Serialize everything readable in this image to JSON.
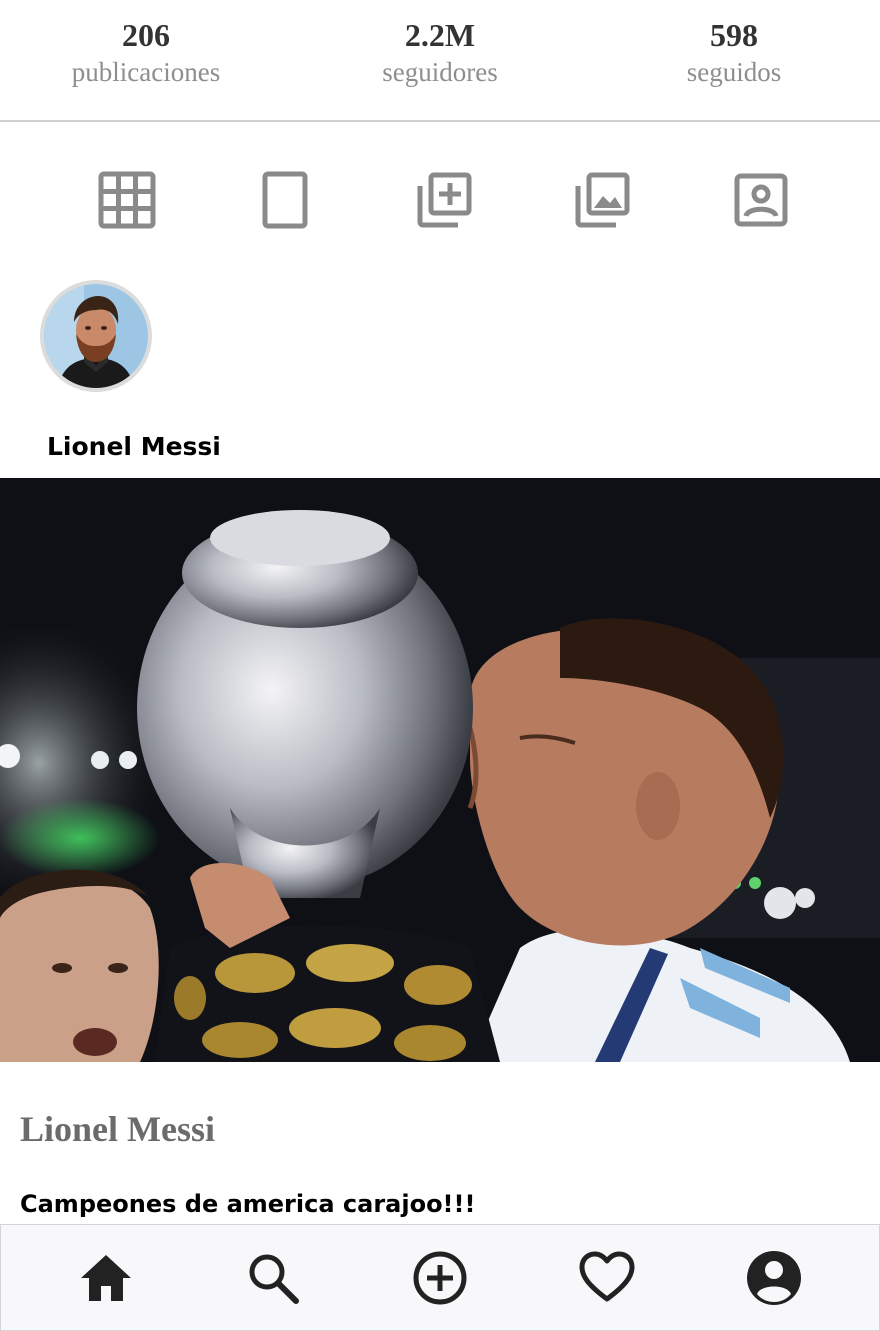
{
  "profile_stats": [
    {
      "value": "206",
      "label": "publicaciones"
    },
    {
      "value": "2.2M",
      "label": "seguidores"
    },
    {
      "value": "598",
      "label": "seguidos"
    }
  ],
  "tabs": [
    {
      "icon": "grid-icon"
    },
    {
      "icon": "portrait-tablet-icon"
    },
    {
      "icon": "add-to-library-icon"
    },
    {
      "icon": "photo-library-icon"
    },
    {
      "icon": "tagged-person-icon"
    }
  ],
  "post": {
    "username": "Lionel Messi",
    "avatar_icon": "profile-avatar",
    "image_alt_description": "player-kissing-trophy-photo",
    "caption_name": "Lionel Messi",
    "caption_text": "Campeones de america carajoo!!!"
  },
  "bottom_nav": [
    {
      "icon": "home-icon"
    },
    {
      "icon": "search-icon"
    },
    {
      "icon": "add-circle-icon"
    },
    {
      "icon": "heart-icon"
    },
    {
      "icon": "account-circle-icon"
    }
  ],
  "colors": {
    "icon_gray": "#8a8a8a",
    "nav_icon": "#222222",
    "stat_number": "#333333",
    "stat_label": "#8e8e8e",
    "nav_background": "#f8f8fb"
  }
}
